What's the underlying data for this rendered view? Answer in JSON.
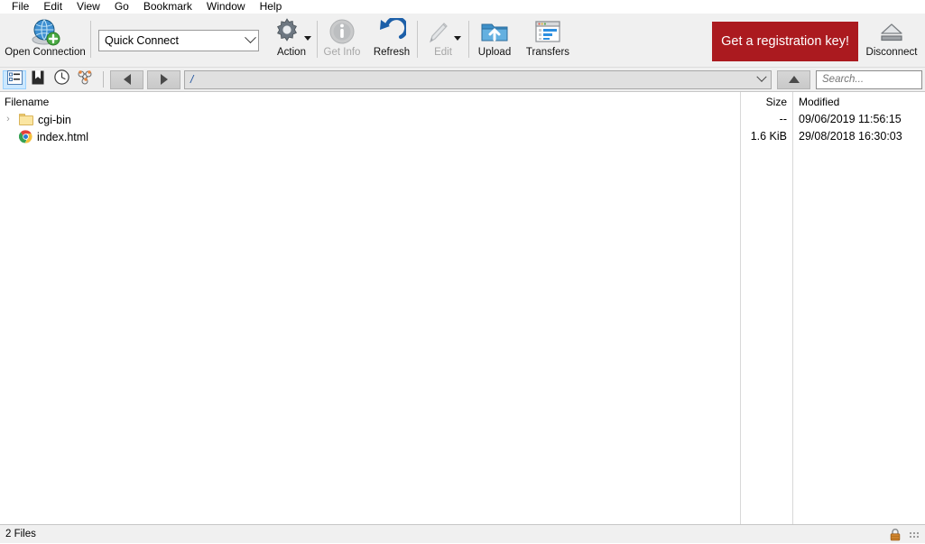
{
  "menubar": {
    "items": [
      {
        "label": "File"
      },
      {
        "label": "Edit"
      },
      {
        "label": "View"
      },
      {
        "label": "Go"
      },
      {
        "label": "Bookmark"
      },
      {
        "label": "Window"
      },
      {
        "label": "Help"
      }
    ]
  },
  "toolbar": {
    "open_connection": {
      "label": "Open Connection",
      "icon": "globe-plus-icon"
    },
    "quick_connect": {
      "value": "Quick Connect",
      "icon": "chevron-down-icon"
    },
    "action": {
      "label": "Action",
      "icon": "gear-icon",
      "has_dropdown": true
    },
    "get_info": {
      "label": "Get Info",
      "icon": "info-icon",
      "disabled": true
    },
    "refresh": {
      "label": "Refresh",
      "icon": "refresh-arrow-icon"
    },
    "edit": {
      "label": "Edit",
      "icon": "pencil-icon",
      "disabled": true,
      "has_dropdown": true
    },
    "upload": {
      "label": "Upload",
      "icon": "upload-folder-icon"
    },
    "transfers": {
      "label": "Transfers",
      "icon": "transfers-window-icon"
    },
    "registration_banner": {
      "label": "Get a registration key!",
      "color": "#ab1a1f"
    },
    "disconnect": {
      "label": "Disconnect",
      "icon": "eject-icon"
    }
  },
  "navbar": {
    "view_browser": {
      "icon": "browser-list-icon",
      "active": true
    },
    "view_bookmarks": {
      "icon": "bookmark-icon",
      "active": false
    },
    "view_history": {
      "icon": "clock-icon",
      "active": false
    },
    "view_connections": {
      "icon": "network-nodes-icon",
      "active": false
    },
    "back": {
      "icon": "triangle-left-icon"
    },
    "forward": {
      "icon": "triangle-right-icon"
    },
    "path": {
      "value": "/",
      "icon": "chevron-down-icon"
    },
    "up": {
      "icon": "triangle-up-icon"
    },
    "search": {
      "placeholder": "Search...",
      "value": "",
      "icon": "search-icon"
    }
  },
  "filelist": {
    "columns": [
      "Filename",
      "Size",
      "Modified"
    ],
    "rows": [
      {
        "name": "cgi-bin",
        "icon": "folder-icon",
        "expandable": true,
        "expander": "›",
        "size": "--",
        "modified": "09/06/2019 11:56:15"
      },
      {
        "name": "index.html",
        "icon": "chrome-icon",
        "expandable": false,
        "expander": "",
        "size": "1.6 KiB",
        "modified": "29/08/2018 16:30:03"
      }
    ]
  },
  "statusbar": {
    "text": "2 Files",
    "lock_icon": "padlock-icon",
    "grip_icon": "resize-grip-icon"
  }
}
